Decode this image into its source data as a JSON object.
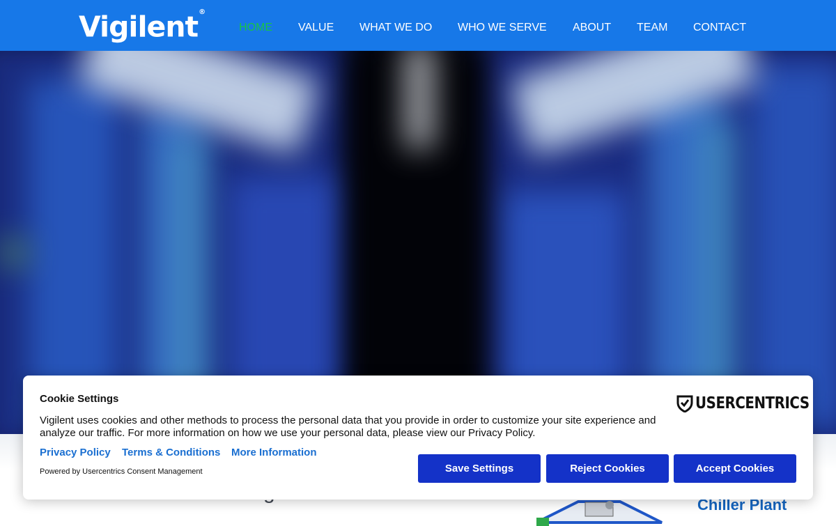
{
  "header": {
    "logo_text": "Vigilent",
    "logo_mark": "®",
    "background": "#1778e8",
    "nav": [
      {
        "label": "HOME",
        "active": true
      },
      {
        "label": "VALUE",
        "active": false
      },
      {
        "label": "WHAT WE DO",
        "active": false
      },
      {
        "label": "WHO WE SERVE",
        "active": false
      },
      {
        "label": "ABOUT",
        "active": false
      },
      {
        "label": "TEAM",
        "active": false
      },
      {
        "label": "CONTACT",
        "active": false
      }
    ],
    "active_color": "#18c24a"
  },
  "hero": {
    "image": "blurred-data-center-server-aisle"
  },
  "below": {
    "partial_text": "g",
    "diagram_label": "Chiller Plant"
  },
  "cookie_banner": {
    "title": "Cookie Settings",
    "body": "Vigilent uses cookies and other methods to process the personal data that you provide in order to customize your site experience and analyze our traffic. For more information on how we use your personal data, please view our Privacy Policy.",
    "links": [
      "Privacy Policy",
      "Terms & Conditions",
      "More Information"
    ],
    "powered_by": "Powered by Usercentrics Consent Management",
    "brand": "USERCENTRICS",
    "buttons": {
      "save": "Save Settings",
      "reject": "Reject Cookies",
      "accept": "Accept Cookies"
    },
    "button_color": "#1432c8",
    "link_color": "#1a6fd1"
  }
}
